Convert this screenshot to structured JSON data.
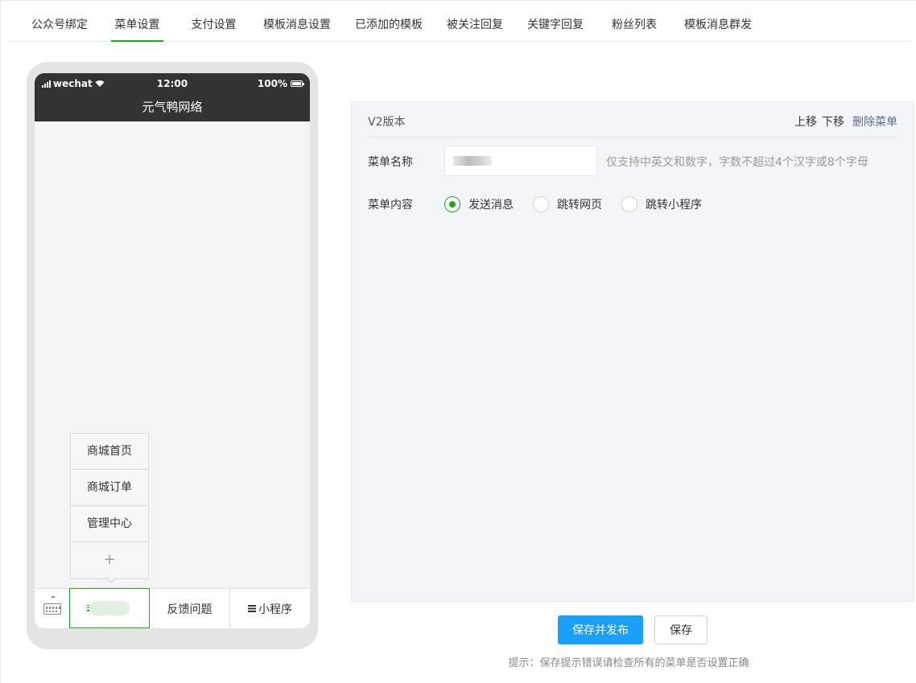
{
  "tabs": [
    {
      "label": "公众号绑定"
    },
    {
      "label": "菜单设置"
    },
    {
      "label": "支付设置"
    },
    {
      "label": "模板消息设置"
    },
    {
      "label": "已添加的模板"
    },
    {
      "label": "被关注回复"
    },
    {
      "label": "关键字回复"
    },
    {
      "label": "粉丝列表"
    },
    {
      "label": "模板消息群发"
    }
  ],
  "active_tab": "菜单设置",
  "phone": {
    "carrier": "wechat",
    "time": "12:00",
    "battery": "100%",
    "title": "元气鸭网络",
    "submenu": [
      "商城首页",
      "商城订单",
      "管理中心",
      "+"
    ],
    "menu": {
      "item2": "反馈问题",
      "item3": "小程序"
    }
  },
  "editor": {
    "version": "V2版本",
    "move_up": "上移",
    "move_down": "下移",
    "delete": "删除菜单",
    "name_label": "菜单名称",
    "name_tip": "仅支持中英文和数字，字数不超过4个汉字或8个字母",
    "content_label": "菜单内容",
    "options": [
      "发送消息",
      "跳转网页",
      "跳转小程序"
    ],
    "selected_option": "发送消息"
  },
  "actions": {
    "publish": "保存并发布",
    "save": "保存"
  },
  "footer_tip": "提示：保存提示错误请检查所有的菜单是否设置正确",
  "colors": {
    "accent_green": "#1aad19",
    "primary_blue": "#1aa0fa",
    "link_blue": "#576b95",
    "phone_header": "#333333"
  }
}
